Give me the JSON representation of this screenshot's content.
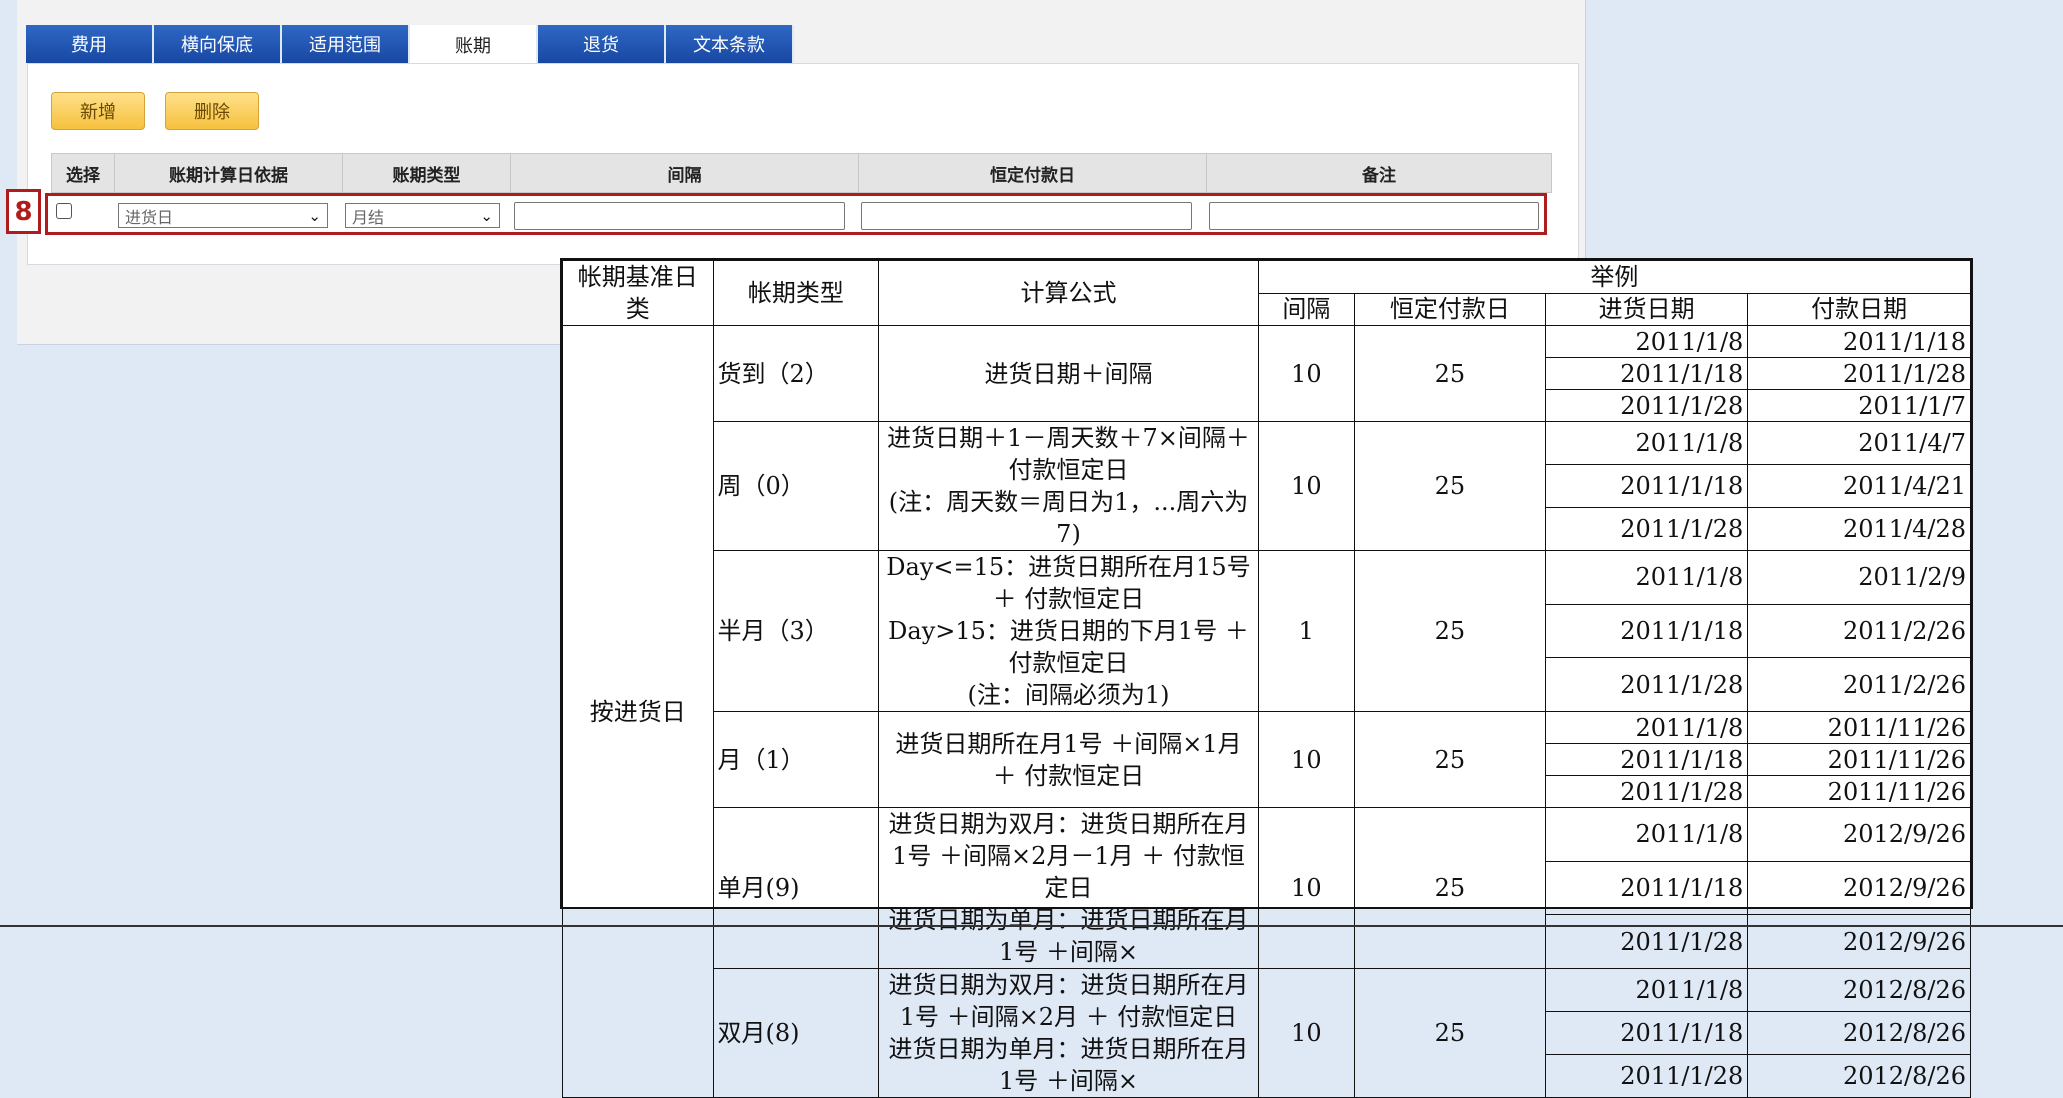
{
  "tabs": [
    {
      "label": "费用",
      "active": false
    },
    {
      "label": "横向保底",
      "active": false
    },
    {
      "label": "适用范围",
      "active": false
    },
    {
      "label": "账期",
      "active": true
    },
    {
      "label": "退货",
      "active": false
    },
    {
      "label": "文本条款",
      "active": false
    }
  ],
  "toolbar": {
    "add_label": "新增",
    "delete_label": "删除"
  },
  "grid": {
    "headers": [
      "选择",
      "账期计算日依据",
      "账期类型",
      "间隔",
      "恒定付款日",
      "备注"
    ],
    "row": {
      "basis_value": "进货日",
      "type_value": "月结",
      "interval": "",
      "fixed_day": "",
      "remark": ""
    }
  },
  "badge": "8",
  "example_table": {
    "headers": {
      "basis": "帐期基准日类",
      "type": "帐期类型",
      "formula": "计算公式",
      "example": "举例",
      "interval": "间隔",
      "fixed_day": "恒定付款日",
      "purchase_date": "进货日期",
      "pay_date": "付款日期"
    },
    "basis_label": "按进货日",
    "groups": [
      {
        "type": "货到（2）",
        "formula": "进货日期＋间隔",
        "interval": "10",
        "fixed_day": "25",
        "rows": [
          [
            "2011/1/8",
            "2011/1/18"
          ],
          [
            "2011/1/18",
            "2011/1/28"
          ],
          [
            "2011/1/28",
            "2011/1/7"
          ]
        ]
      },
      {
        "type": "周（0）",
        "formula": "进货日期＋1－周天数＋7×间隔＋付款恒定日\n(注：周天数＝周日为1，...周六为7)",
        "interval": "10",
        "fixed_day": "25",
        "rows": [
          [
            "2011/1/8",
            "2011/4/7"
          ],
          [
            "2011/1/18",
            "2011/4/21"
          ],
          [
            "2011/1/28",
            "2011/4/28"
          ]
        ]
      },
      {
        "type": "半月（3）",
        "formula": "Day<=15：进货日期所在月15号 ＋ 付款恒定日\nDay>15：进货日期的下月1号 ＋ 付款恒定日\n(注：间隔必须为1)",
        "interval": "1",
        "fixed_day": "25",
        "rows": [
          [
            "2011/1/8",
            "2011/2/9"
          ],
          [
            "2011/1/18",
            "2011/2/26"
          ],
          [
            "2011/1/28",
            "2011/2/26"
          ]
        ]
      },
      {
        "type": "月（1）",
        "formula": "进货日期所在月1号 ＋间隔×1月 ＋ 付款恒定日",
        "interval": "10",
        "fixed_day": "25",
        "rows": [
          [
            "2011/1/8",
            "2011/11/26"
          ],
          [
            "2011/1/18",
            "2011/11/26"
          ],
          [
            "2011/1/28",
            "2011/11/26"
          ]
        ]
      },
      {
        "type": "单月(9)",
        "formula": "进货日期为双月：进货日期所在月1号 ＋间隔×2月－1月 ＋ 付款恒定日\n进货日期为单月：进货日期所在月1号 ＋间隔×",
        "interval": "10",
        "fixed_day": "25",
        "rows": [
          [
            "2011/1/8",
            "2012/9/26"
          ],
          [
            "2011/1/18",
            "2012/9/26"
          ],
          [
            "2011/1/28",
            "2012/9/26"
          ]
        ]
      },
      {
        "type": "双月(8)",
        "formula": "进货日期为双月：进货日期所在月1号 ＋间隔×2月 ＋ 付款恒定日\n进货日期为单月：进货日期所在月1号 ＋间隔×",
        "interval": "10",
        "fixed_day": "25",
        "rows": [
          [
            "2011/1/8",
            "2012/8/26"
          ],
          [
            "2011/1/18",
            "2012/8/26"
          ],
          [
            "2011/1/28",
            "2012/8/26"
          ]
        ]
      }
    ]
  }
}
